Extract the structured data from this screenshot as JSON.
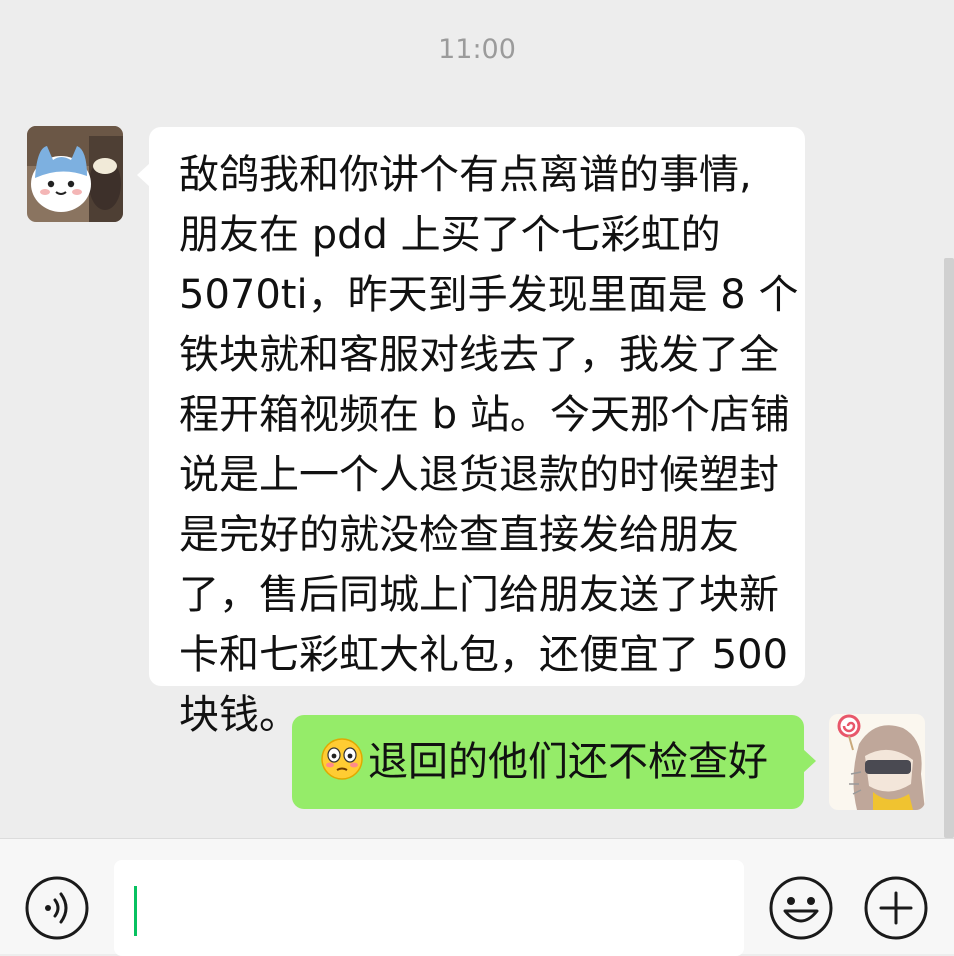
{
  "chat": {
    "timestamp": "11:00",
    "incoming_message": {
      "lines": [
        "敌鸽我和你讲个有点离谱的事情,",
        "朋友在 pdd 上买了个七彩虹的",
        "5070ti，昨天到手发现里面是 8 个",
        "铁块就和客服对线去了，我发了全",
        "程开箱视频在 b 站。今天那个店铺",
        "说是上一个人退货退款的时候塑封",
        "是完好的就没检查直接发给朋友",
        "了，售后同城上门给朋友送了块新",
        "卡和七彩虹大礼包，还便宜了 500",
        "块钱。"
      ]
    },
    "outgoing_message": {
      "emoji": "flushed-face-emoji",
      "text": "退回的他们还不检查好"
    }
  },
  "input_bar": {
    "voice_icon": "voice-icon",
    "emoji_icon": "smile-icon",
    "plus_icon": "plus-icon",
    "input_value": ""
  },
  "colors": {
    "background": "#ededed",
    "incoming_bubble": "#ffffff",
    "outgoing_bubble": "#95ec69",
    "caret": "#07c160"
  }
}
